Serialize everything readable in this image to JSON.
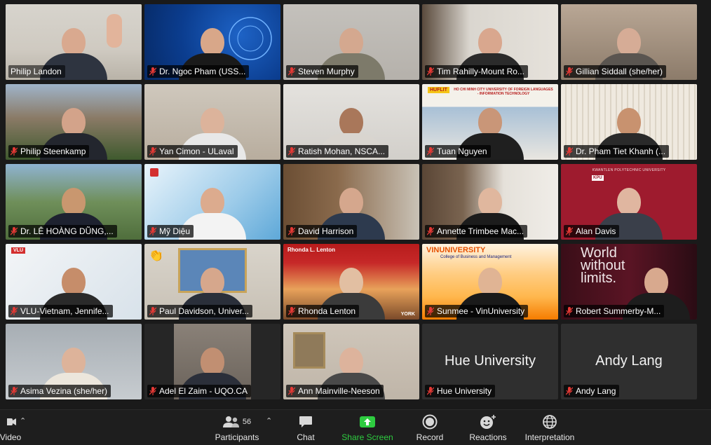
{
  "participants": [
    {
      "name": "Philip Landon",
      "muted": false,
      "active": true
    },
    {
      "name": "Dr. Ngoc Pham (USS...",
      "muted": true
    },
    {
      "name": "Steven Murphy",
      "muted": true
    },
    {
      "name": "Tim Rahilly-Mount Ro...",
      "muted": true
    },
    {
      "name": "Gillian Siddall (she/her)",
      "muted": true
    },
    {
      "name": "Philip Steenkamp",
      "muted": true
    },
    {
      "name": "Yan Cimon - ULaval",
      "muted": true
    },
    {
      "name": "Ratish Mohan, NSCA...",
      "muted": true
    },
    {
      "name": "Tuan Nguyen",
      "muted": true
    },
    {
      "name": "Dr. Pham Tiet Khanh (...",
      "muted": true
    },
    {
      "name": "Dr. LÊ HOÀNG DŨNG,...",
      "muted": true
    },
    {
      "name": "Mỹ Diệu",
      "muted": true
    },
    {
      "name": "David Harrison",
      "muted": true
    },
    {
      "name": "Annette Trimbee Mac...",
      "muted": true
    },
    {
      "name": "Alan Davis",
      "muted": true
    },
    {
      "name": "VLU-Vietnam, Jennife...",
      "muted": true
    },
    {
      "name": "Paul Davidson, Univer...",
      "muted": true
    },
    {
      "name": "Rhonda Lenton",
      "muted": true
    },
    {
      "name": "Sunmee - VinUniversity",
      "muted": true
    },
    {
      "name": "Robert Summerby-M...",
      "muted": true
    },
    {
      "name": "Asima Vezina (she/her)",
      "muted": true
    },
    {
      "name": "Adel El Zaim - UQO.CA",
      "muted": true
    },
    {
      "name": "Ann Mainville-Neeson",
      "muted": true
    },
    {
      "name": "Hue University",
      "muted": true,
      "video_off": true,
      "display_name": "Hue University"
    },
    {
      "name": "Andy Lang",
      "muted": true,
      "video_off": true,
      "display_name": "Andy Lang"
    }
  ],
  "backdrop_text": {
    "tuan_banner": "HUFLIT",
    "tuan_banner_sub": "HO CHI MINH CITY UNIVERSITY OF FOREIGN LANGUAGES - INFORMATION TECHNOLOGY",
    "alan_banner": "KWANTLEN POLYTECHNIC UNIVERSITY",
    "alan_logo": "KPU",
    "vlu_logo": "VLU",
    "rhonda_banner": "Rhonda L. Lenton",
    "rhonda_logo": "YORK",
    "vin_banner": "VINUNIVERSITY",
    "vin_sub": "College of Business and Management",
    "robert_slogan_1": "World",
    "robert_slogan_2": "without",
    "robert_slogan_3": "limits."
  },
  "reaction_emoji": "👏",
  "toolbar": {
    "video": "Video",
    "participants": "Participants",
    "participants_count": "56",
    "chat": "Chat",
    "share": "Share Screen",
    "record": "Record",
    "reactions": "Reactions",
    "interpretation": "Interpretation"
  },
  "colors": {
    "active_border": "#d4e157",
    "share_green": "#2ecc40",
    "muted_red": "#e53935",
    "toolbar_bg": "#1e1e1e"
  }
}
